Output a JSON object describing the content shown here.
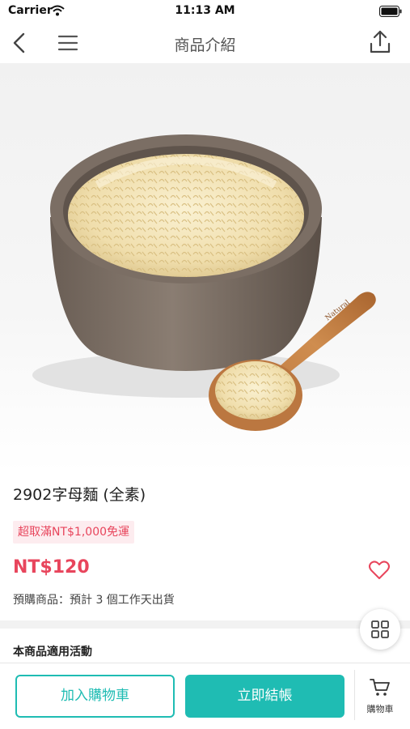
{
  "status_bar": {
    "carrier": "Carrier",
    "time": "11:13 AM"
  },
  "nav": {
    "title": "商品介紹",
    "back_icon": "chevron-left-icon",
    "menu_icon": "hamburger-menu-icon",
    "share_icon": "share-upload-icon"
  },
  "product": {
    "name": "2902字母麵 (全素)",
    "promo_tag": "超取滿NT$1,000免運",
    "price": "NT$120",
    "shipping_note": "預購商品：預計 3 個工作天出貨",
    "favorite_icon": "heart-outline-icon",
    "spoon_engraving": "Natural"
  },
  "activity": {
    "title": "本商品適用活動"
  },
  "fab": {
    "icon": "grid-apps-icon"
  },
  "bottom_bar": {
    "add_to_cart_label": "加入購物車",
    "checkout_label": "立即結帳",
    "cart_label": "購物車",
    "cart_icon": "cart-icon"
  },
  "colors": {
    "accent": "#1fbcb3",
    "price": "#e8455c",
    "promo_bg": "#fdecef"
  }
}
